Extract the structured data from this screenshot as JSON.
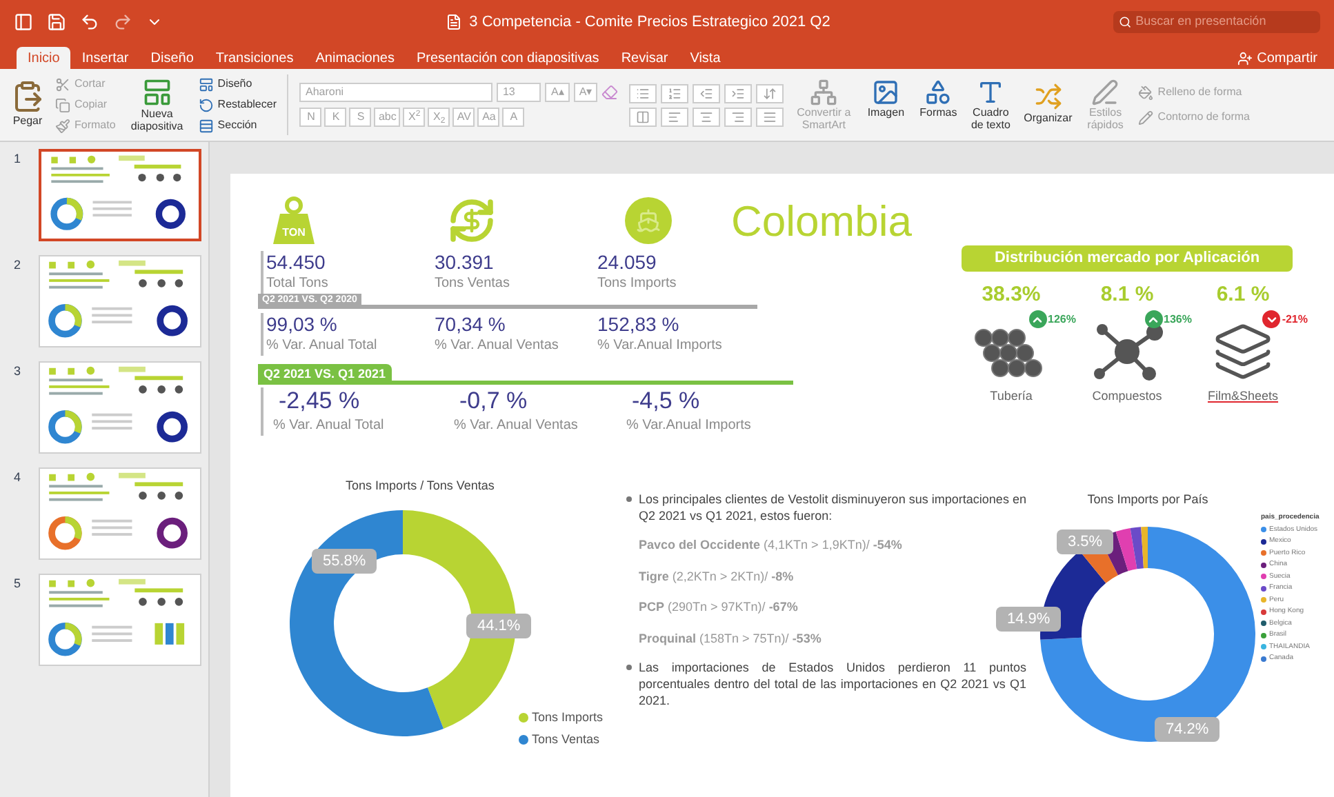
{
  "window": {
    "title": "3 Competencia - Comite Precios Estrategico 2021 Q2"
  },
  "search": {
    "placeholder": "Buscar en presentación"
  },
  "tabs": [
    {
      "label": "Inicio",
      "selected": true
    },
    {
      "label": "Insertar",
      "selected": false
    },
    {
      "label": "Diseño",
      "selected": false
    },
    {
      "label": "Transiciones",
      "selected": false
    },
    {
      "label": "Animaciones",
      "selected": false
    },
    {
      "label": "Presentación con diapositivas",
      "selected": false
    },
    {
      "label": "Revisar",
      "selected": false
    },
    {
      "label": "Vista",
      "selected": false
    }
  ],
  "share_button": "Compartir",
  "ribbon": {
    "paste": "Pegar",
    "clipboard": [
      {
        "label": "Cortar",
        "disabled": true
      },
      {
        "label": "Copiar",
        "disabled": true
      },
      {
        "label": "Formato",
        "disabled": true
      }
    ],
    "new_slide": "Nueva diapositiva",
    "slide_commands": [
      "Diseño",
      "Restablecer",
      "Sección"
    ],
    "font": {
      "name": "Aharoni",
      "size": "13",
      "disabled": true
    },
    "font_size_buttons": [
      "A▴",
      "A▾"
    ],
    "format_buttons": [
      "N",
      "K",
      "S",
      "abc",
      "X$^{2}$",
      "X$_{2}$",
      "AV",
      "Aa",
      "A"
    ],
    "smartart": {
      "label": "Convertir a SmartArt",
      "disabled": true
    },
    "insert_commands": [
      "Imagen",
      "Formas",
      "Cuadro de texto"
    ],
    "arrange": "Organizar",
    "quick_styles": {
      "label": "Estilos rápidos",
      "disabled": true
    },
    "shape_commands": [
      {
        "label": "Relleno de forma",
        "disabled": true
      },
      {
        "label": "Contorno de forma",
        "disabled": true
      }
    ]
  },
  "thumbnails": [
    {
      "number": "1",
      "selected": true
    },
    {
      "number": "2",
      "selected": false
    },
    {
      "number": "3",
      "selected": false
    },
    {
      "number": "4",
      "selected": false
    },
    {
      "number": "5",
      "selected": false
    }
  ],
  "slide": {
    "title": "Colombia",
    "weight_label": "TON",
    "metrics": [
      {
        "value": "54.450",
        "label": "Total Tons"
      },
      {
        "value": "30.391",
        "label": "Tons Ventas"
      },
      {
        "value": "24.059",
        "label": "Tons Imports"
      }
    ],
    "comparisons": [
      {
        "kind": "annual",
        "heading": "Q2 2021 VS. Q2 2020",
        "metrics": [
          {
            "value": "99,03 %",
            "label": "% Var. Anual Total"
          },
          {
            "value": "70,34 %",
            "label": "% Var. Anual Ventas"
          },
          {
            "value": "152,83 %",
            "label": "% Var.Anual Imports"
          }
        ]
      },
      {
        "kind": "quarterly",
        "heading": "Q2 2021 VS. Q1 2021",
        "metrics": [
          {
            "value": "-2,45 %",
            "label": "% Var. Anual Total"
          },
          {
            "value": "-0,7 %",
            "label": "% Var. Anual Ventas"
          },
          {
            "value": "-4,5 %",
            "label": "% Var.Anual Imports"
          }
        ]
      }
    ],
    "distribution": {
      "title": "Distribución mercado por Aplicación",
      "applications": [
        {
          "kind": "pipes",
          "share": "38.3%",
          "change": "126%",
          "rising": true,
          "label": "Tubería"
        },
        {
          "kind": "compounds",
          "share": "8.1 %",
          "change": "136%",
          "rising": true,
          "label": "Compuestos"
        },
        {
          "kind": "sheets",
          "share": "6.1 %",
          "change": "-21%",
          "rising": false,
          "label": "Film&Sheets"
        }
      ]
    },
    "bullets": [
      {
        "text": "Los principales clientes de Vestolit disminuyeron sus importaciones en Q2 2021 vs Q1 2021, estos fueron:",
        "clients": [
          "**Pavco del Occidente** (4,1KTn > 1,9KTn)/ **-54%**",
          "**Tigre** (2,2KTn > 2KTn)/ **-8%**",
          "**PCP** (290Tn > 97KTn)/ **-67%**",
          "**Proquinal** (158Tn > 75Tn)/ **-53%**"
        ]
      },
      {
        "text": "Las importaciones de Estados Unidos perdieron 11 puntos porcentuales dentro del total de las importaciones en Q2 2021 vs Q1 2021."
      }
    ],
    "charts": [
      {
        "legend": [
          {
            "color": "#b8d433"
          },
          {
            "color": "#2f86d1"
          }
        ],
        "chart_data": {
          "type": "donut",
          "title": "Tons Imports / Tons Ventas",
          "categories": [
            "Tons Imports",
            "Tons Ventas"
          ],
          "values": [
            44.1,
            55.8
          ],
          "value_labels": [
            "44.1%",
            "55.8%"
          ]
        }
      },
      {
        "legend_title": "pais_procedencia",
        "legend": [
          {
            "color": "#3b8fe8"
          },
          {
            "color": "#1c2a96"
          },
          {
            "color": "#e8702a"
          },
          {
            "color": "#6b1f7c"
          },
          {
            "color": "#e03fb0"
          },
          {
            "color": "#6b4bc8"
          },
          {
            "color": "#e8b52a"
          },
          {
            "color": "#d83a3a"
          },
          {
            "color": "#1f5c6b"
          },
          {
            "color": "#3aa03a"
          },
          {
            "color": "#3ab5e0"
          },
          {
            "color": "#3a7ad0"
          }
        ],
        "chart_data": {
          "type": "donut",
          "title": "Tons Imports por País",
          "categories": [
            "Estados Unidos",
            "Mexico",
            "Puerto Rico",
            "China",
            "Suecia",
            "Francia",
            "Peru",
            "Hong Kong",
            "Belgica",
            "Brasil",
            "THAILANDIA",
            "Canada"
          ],
          "values": [
            74.2,
            14.9,
            3.5,
            2.6,
            2.2,
            1.6,
            1.0,
            null,
            null,
            null,
            null,
            null
          ],
          "value_labels": [
            "74.2%",
            "14.9%",
            "3.5%",
            null,
            null,
            null,
            null,
            null,
            null,
            null,
            null,
            null
          ]
        }
      }
    ]
  }
}
